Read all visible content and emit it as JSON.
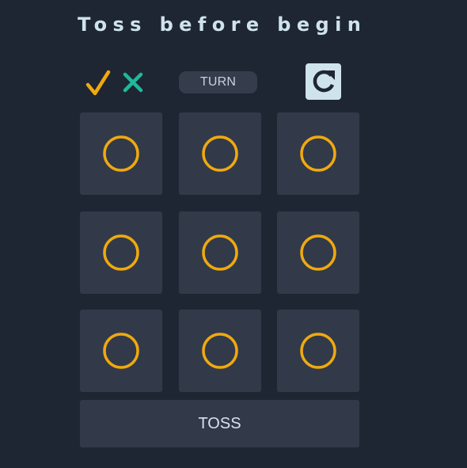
{
  "title": "Toss before begin",
  "status": {
    "icons": [
      "check-icon",
      "x-icon"
    ],
    "turn_label": "TURN"
  },
  "reset_icon": "reset-icon",
  "board": {
    "cells": [
      "O",
      "O",
      "O",
      "O",
      "O",
      "O",
      "O",
      "O",
      "O"
    ]
  },
  "toss_label": "TOSS",
  "colors": {
    "background": "#1f2633",
    "cell": "#323a4a",
    "o_mark": "#f0a90e",
    "check": "#f0a90e",
    "x_mark": "#1fb89a",
    "title": "#cfe3ec",
    "reset_button": "#cfe3ec"
  }
}
